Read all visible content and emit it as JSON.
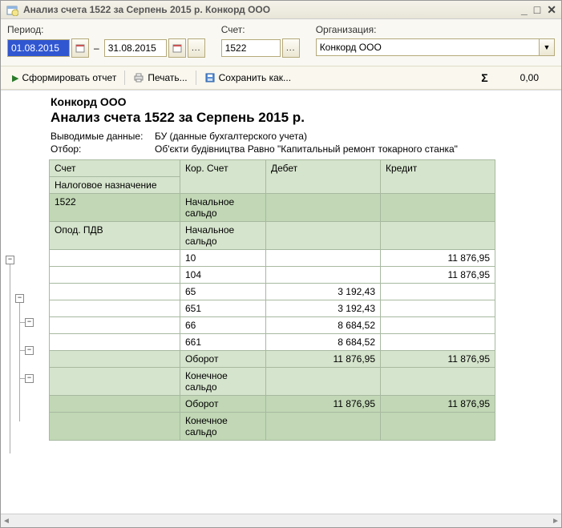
{
  "window": {
    "title": "Анализ счета 1522 за Серпень 2015 р. Конкорд ООО"
  },
  "filters": {
    "period_label": "Период:",
    "date_from": "01.08.2015",
    "date_to": "31.08.2015",
    "account_label": "Счет:",
    "account": "1522",
    "org_label": "Организация:",
    "org": "Конкорд ООО"
  },
  "actions": {
    "form": "Сформировать отчет",
    "print": "Печать...",
    "save_as": "Сохранить как...",
    "sum_value": "0,00"
  },
  "report": {
    "org": "Конкорд ООО",
    "title": "Анализ счета 1522 за Серпень 2015 р.",
    "data_label": "Выводимые данные:",
    "data_value": "БУ (данные бухгалтерского учета)",
    "filter_label": "Отбор:",
    "filter_value": "Об'єкти будівництва Равно \"Капитальный ремонт токарного станка\"",
    "headers": {
      "acct": "Счет",
      "tax": "Налоговое назначение",
      "kor": "Кор. Счет",
      "debit": "Дебет",
      "credit": "Кредит",
      "start_bal": "Начальное сальдо",
      "start_bal_sub": "Начальное сальдо",
      "turnover": "Оборот",
      "end_bal": "Конечное сальдо"
    },
    "main_acct": "1522",
    "tax_group": "Опод. ПДВ",
    "rows": [
      {
        "kor": "10",
        "debit": "",
        "credit": "11 876,95"
      },
      {
        "kor": "104",
        "debit": "",
        "credit": "11 876,95",
        "sub": true
      },
      {
        "kor": "65",
        "debit": "3 192,43",
        "credit": ""
      },
      {
        "kor": "651",
        "debit": "3 192,43",
        "credit": "",
        "sub": true
      },
      {
        "kor": "66",
        "debit": "8 684,52",
        "credit": ""
      },
      {
        "kor": "661",
        "debit": "8 684,52",
        "credit": "",
        "sub": true
      }
    ],
    "sub_turnover": {
      "debit": "11 876,95",
      "credit": "11 876,95"
    },
    "sub_endbal": {
      "debit": "",
      "credit": ""
    },
    "main_turnover": {
      "debit": "11 876,95",
      "credit": "11 876,95"
    },
    "main_endbal": {
      "debit": "",
      "credit": ""
    }
  }
}
